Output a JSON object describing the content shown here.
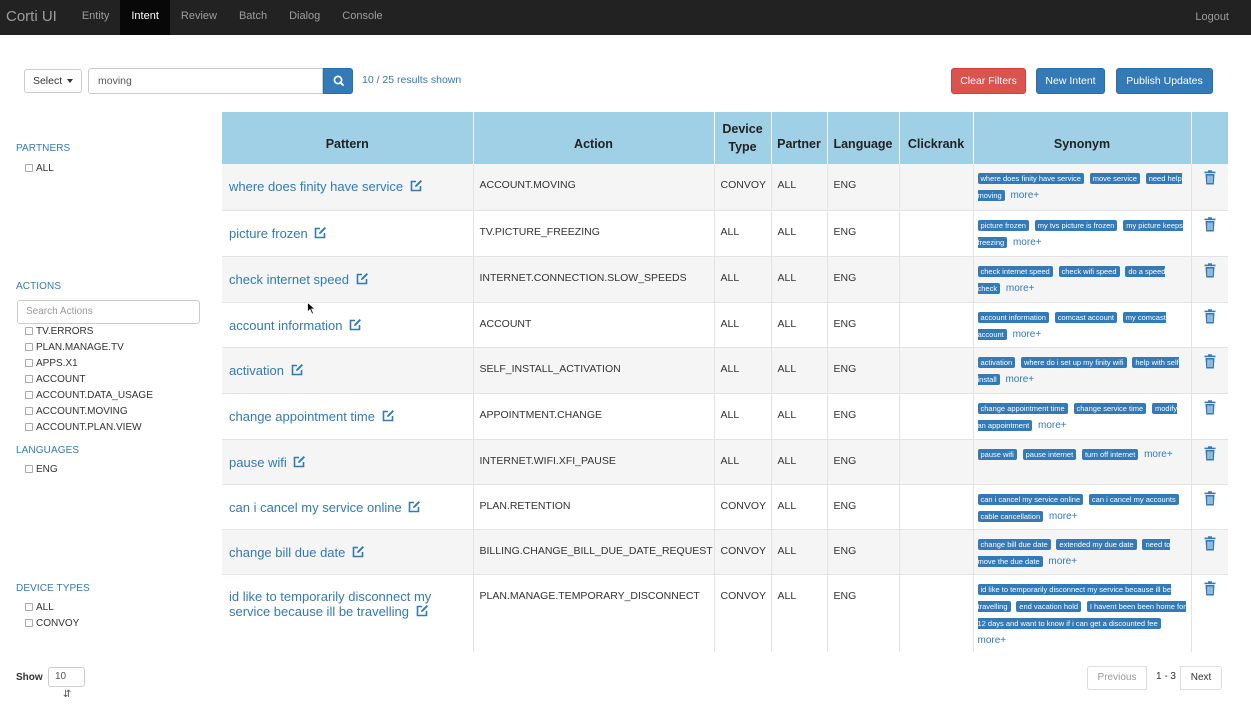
{
  "navbar": {
    "brand": "Corti UI",
    "items": [
      "Entity",
      "Intent",
      "Review",
      "Batch",
      "Dialog",
      "Console"
    ],
    "active": "Intent",
    "logout": "Logout"
  },
  "toolbar": {
    "select_label": "Select",
    "search_value": "moving",
    "results_text": "10 / 25 results shown",
    "clear_filters": "Clear Filters",
    "new_intent": "New Intent",
    "publish_updates": "Publish Updates"
  },
  "sidebar": {
    "partners": {
      "heading": "PARTNERS",
      "items": [
        "ALL"
      ]
    },
    "actions": {
      "heading": "ACTIONS",
      "search_placeholder": "Search Actions",
      "items": [
        "TV.ERRORS",
        "PLAN.MANAGE.TV",
        "APPS.X1",
        "ACCOUNT",
        "ACCOUNT.DATA_USAGE",
        "ACCOUNT.MOVING",
        "ACCOUNT.PLAN.VIEW"
      ]
    },
    "languages": {
      "heading": "LANGUAGES",
      "items": [
        "ENG"
      ]
    },
    "device_types": {
      "heading": "DEVICE TYPES",
      "items": [
        "ALL",
        "CONVOY"
      ]
    }
  },
  "table": {
    "headers": {
      "pattern": "Pattern",
      "action": "Action",
      "device_type_1": "Device",
      "device_type_2": "Type",
      "partner": "Partner",
      "language": "Language",
      "clickrank": "Clickrank",
      "synonym": "Synonym"
    },
    "more_label": "more+",
    "rows": [
      {
        "pattern": "where does finity have service",
        "action": "ACCOUNT.MOVING",
        "device": "CONVOY",
        "partner": "ALL",
        "language": "ENG",
        "clickrank": "",
        "synonyms": [
          "where does finity have service",
          "move service",
          "need help moving"
        ]
      },
      {
        "pattern": "picture frozen",
        "action": "TV.PICTURE_FREEZING",
        "device": "ALL",
        "partner": "ALL",
        "language": "ENG",
        "clickrank": "",
        "synonyms": [
          "picture frozen",
          "my tvs picture is frozen",
          "my picture keeps freezing"
        ]
      },
      {
        "pattern": "check internet speed",
        "action": "INTERNET.CONNECTION.SLOW_SPEEDS",
        "device": "ALL",
        "partner": "ALL",
        "language": "ENG",
        "clickrank": "",
        "synonyms": [
          "check internet speed",
          "check wifi speed",
          "do a speed check"
        ]
      },
      {
        "pattern": "account information",
        "action": "ACCOUNT",
        "device": "ALL",
        "partner": "ALL",
        "language": "ENG",
        "clickrank": "",
        "synonyms": [
          "account information",
          "comcast account",
          "my comcast account"
        ]
      },
      {
        "pattern": "activation",
        "action": "SELF_INSTALL_ACTIVATION",
        "device": "ALL",
        "partner": "ALL",
        "language": "ENG",
        "clickrank": "",
        "synonyms": [
          "activation",
          "where do i set up my finity wifi",
          "help with self install"
        ]
      },
      {
        "pattern": "change appointment time",
        "action": "APPOINTMENT.CHANGE",
        "device": "ALL",
        "partner": "ALL",
        "language": "ENG",
        "clickrank": "",
        "synonyms": [
          "change appointment time",
          "change service time",
          "modify an appointment"
        ]
      },
      {
        "pattern": "pause wifi",
        "action": "INTERNET.WIFI.XFI_PAUSE",
        "device": "ALL",
        "partner": "ALL",
        "language": "ENG",
        "clickrank": "",
        "synonyms": [
          "pause wifi",
          "pause internet",
          "turn off internet"
        ]
      },
      {
        "pattern": "can i cancel my service online",
        "action": "PLAN.RETENTION",
        "device": "CONVOY",
        "partner": "ALL",
        "language": "ENG",
        "clickrank": "",
        "synonyms": [
          "can i cancel my service online",
          "can i cancel my accounts",
          "cable cancellation"
        ]
      },
      {
        "pattern": "change bill due date",
        "action": "BILLING.CHANGE_BILL_DUE_DATE_REQUEST",
        "device": "CONVOY",
        "partner": "ALL",
        "language": "ENG",
        "clickrank": "",
        "synonyms": [
          "change bill due date",
          "extended my due date",
          "need to move the due date"
        ]
      },
      {
        "pattern": "id like to temporarily disconnect my service because ill be travelling",
        "action": "PLAN.MANAGE.TEMPORARY_DISCONNECT",
        "device": "CONVOY",
        "partner": "ALL",
        "language": "ENG",
        "clickrank": "",
        "synonyms": [
          "id like to temporarily disconnect my service because ill be travelling",
          "end vacation hold",
          "I havent been been home for 12 days and want to know if i can get a discounted fee"
        ]
      }
    ]
  },
  "footer": {
    "show_label": "Show",
    "show_value": "10",
    "previous": "Previous",
    "pages": "1 - 3",
    "next": "Next"
  },
  "colors": {
    "navbar": "#222222",
    "primary": "#337ab7",
    "danger": "#d9534f",
    "table_header": "#9fd0e6"
  }
}
